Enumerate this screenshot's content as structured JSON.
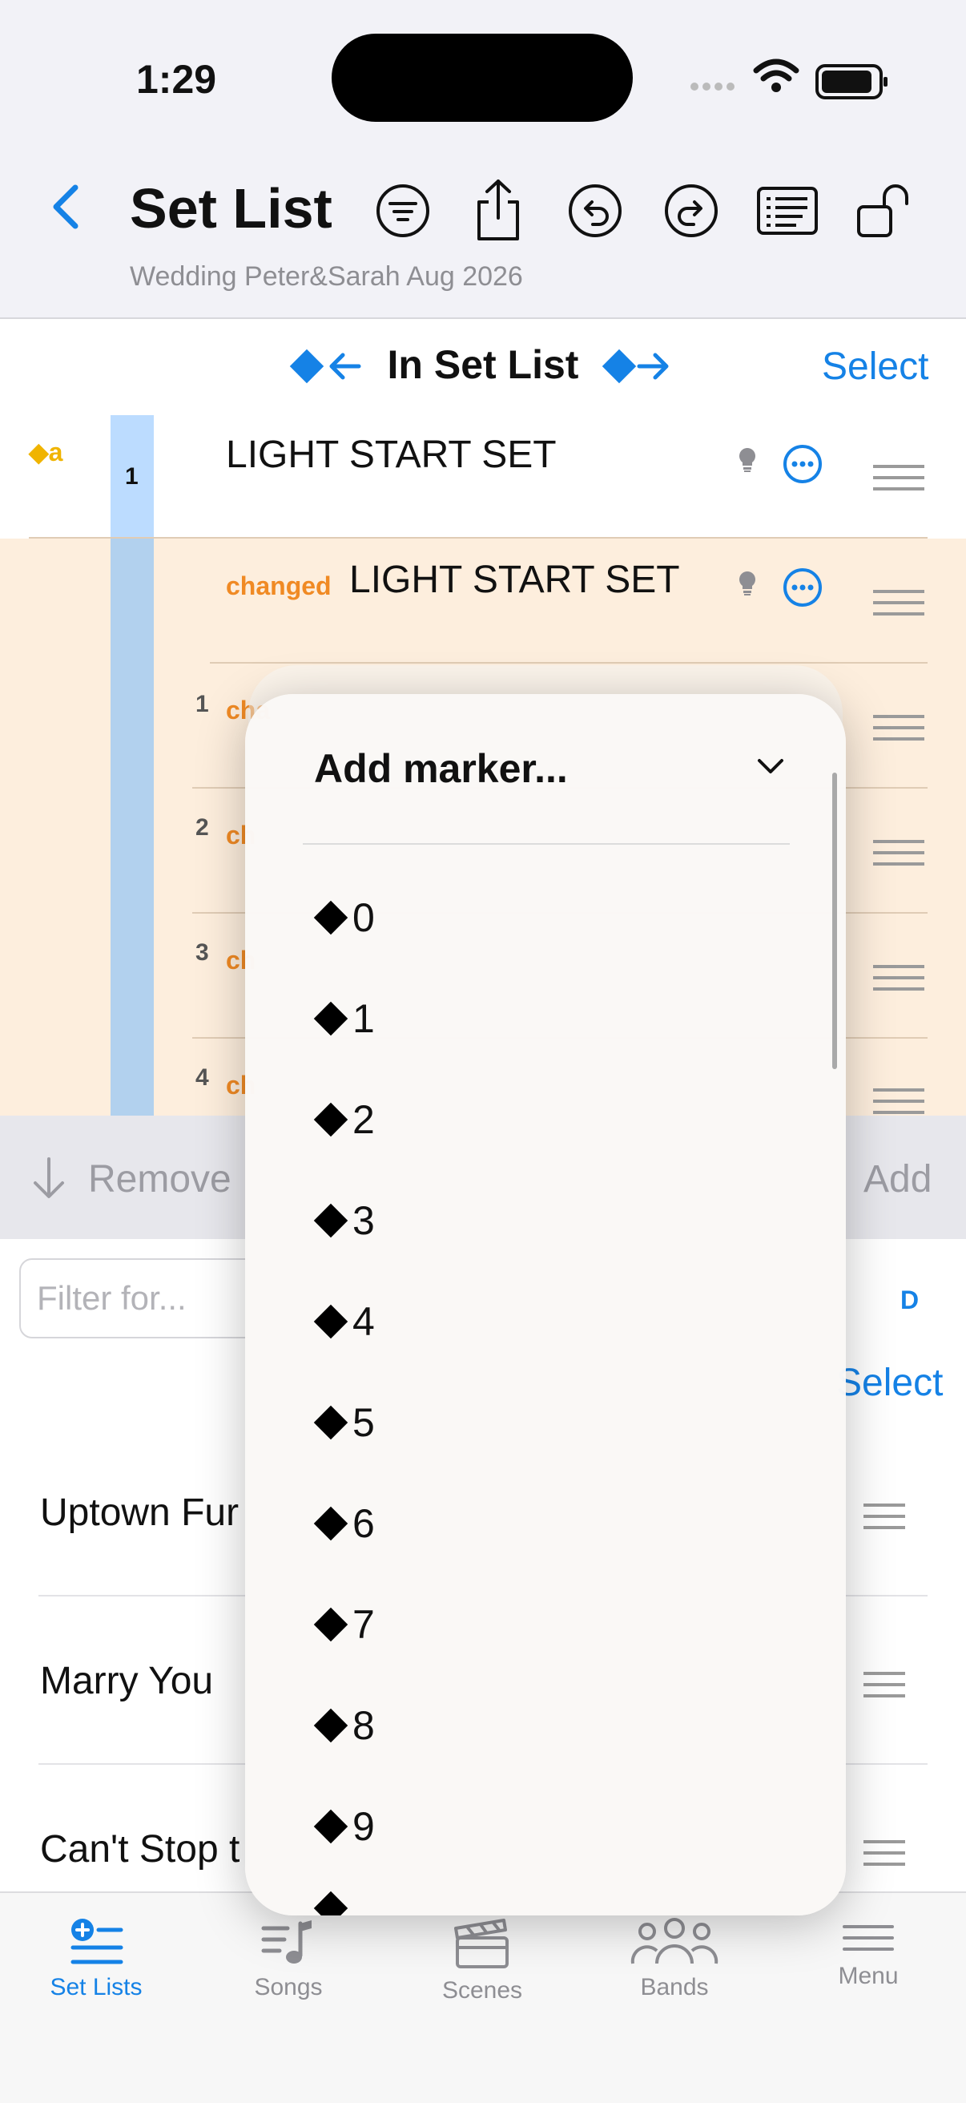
{
  "status": {
    "time": "1:29"
  },
  "nav": {
    "title": "Set List",
    "subtitle": "Wedding Peter&Sarah Aug 2026"
  },
  "section": {
    "title": "In Set List",
    "select_label": "Select"
  },
  "setlist": {
    "marker_label": "a",
    "row1": {
      "number": "1",
      "title": "LIGHT START SET"
    },
    "row2": {
      "changed_label": "changed",
      "title": "LIGHT START SET"
    },
    "rows": [
      {
        "number": "1",
        "changed_label": "cha"
      },
      {
        "number": "2",
        "changed_label": "ch"
      },
      {
        "number": "3",
        "changed_label": "ch"
      },
      {
        "number": "4",
        "changed_label": "ch"
      }
    ]
  },
  "actions": {
    "remove_label": "Remove",
    "add_label": "Add"
  },
  "library": {
    "filter_placeholder": "Filter for...",
    "d_label": "D",
    "select_label": "Select",
    "songs": [
      "Uptown Fur",
      "Marry You",
      "Can't Stop t"
    ]
  },
  "popup": {
    "title": "Add marker...",
    "markers": [
      "0",
      "1",
      "2",
      "3",
      "4",
      "5",
      "6",
      "7",
      "8",
      "9"
    ]
  },
  "tabs": [
    {
      "label": "Set Lists",
      "icon": "set-lists-icon",
      "active": true
    },
    {
      "label": "Songs",
      "icon": "songs-icon",
      "active": false
    },
    {
      "label": "Scenes",
      "icon": "scenes-icon",
      "active": false
    },
    {
      "label": "Bands",
      "icon": "bands-icon",
      "active": false
    },
    {
      "label": "Menu",
      "icon": "menu-icon",
      "active": false
    }
  ],
  "colors": {
    "accent": "#1582e6",
    "changed": "#f08a24",
    "marker": "#f0b400",
    "row_highlight": "#fdeedd"
  }
}
